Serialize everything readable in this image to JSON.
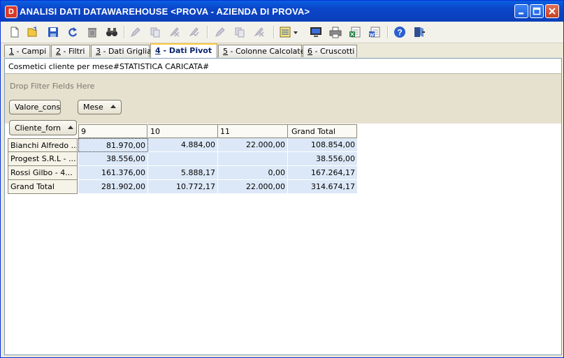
{
  "window": {
    "title": "ANALISI DATI DATAWAREHOUSE <PROVA - AZIENDA DI PROVA>",
    "app_icon_letter": "D"
  },
  "toolbar": {
    "buttons": [
      {
        "name": "new",
        "icon": "new-document-icon",
        "enabled": true
      },
      {
        "name": "open",
        "icon": "open-folder-icon",
        "enabled": true
      },
      {
        "name": "save",
        "icon": "save-disk-icon",
        "enabled": true
      },
      {
        "name": "refresh",
        "icon": "refresh-icon",
        "enabled": true
      },
      {
        "name": "delete",
        "icon": "trash-icon",
        "enabled": true
      },
      {
        "name": "find",
        "icon": "binoculars-icon",
        "enabled": true
      },
      {
        "name": "edit",
        "icon": "edit-pencil-icon",
        "enabled": false
      },
      {
        "name": "copy",
        "icon": "copy-icon",
        "enabled": false
      },
      {
        "name": "cancel",
        "icon": "cancel-x-icon",
        "enabled": false
      },
      {
        "name": "confirm",
        "icon": "confirm-check-icon",
        "enabled": false
      },
      {
        "name": "edit-2",
        "icon": "edit-pencil-icon",
        "enabled": false
      },
      {
        "name": "copy-2",
        "icon": "copy-icon",
        "enabled": false
      },
      {
        "name": "cancel-2",
        "icon": "cancel-x-icon",
        "enabled": false
      },
      {
        "name": "layout-menu",
        "icon": "list-dropdown-icon",
        "enabled": true
      },
      {
        "name": "monitor",
        "icon": "monitor-icon",
        "enabled": true
      },
      {
        "name": "print",
        "icon": "printer-icon",
        "enabled": true
      },
      {
        "name": "export-excel",
        "icon": "excel-export-icon",
        "enabled": true
      },
      {
        "name": "export-word",
        "icon": "word-export-icon",
        "enabled": true
      },
      {
        "name": "help",
        "icon": "help-icon",
        "enabled": true
      },
      {
        "name": "exit",
        "icon": "exit-door-icon",
        "enabled": true
      }
    ]
  },
  "tabs": [
    {
      "key": "1",
      "label": " - Campi"
    },
    {
      "key": "2",
      "label": " - Filtri"
    },
    {
      "key": "3",
      "label": " - Dati Griglia"
    },
    {
      "key": "4",
      "label": " - Dati Pivot",
      "active": true
    },
    {
      "key": "5",
      "label": " - Colonne Calcolate"
    },
    {
      "key": "6",
      "label": " - Cruscotti"
    }
  ],
  "pivot": {
    "caption": "Cosmetici cliente per mese#STATISTICA CARICATA#",
    "filter_hint": "Drop Filter Fields Here",
    "data_field": "Valore_cons",
    "column_field": "Mese",
    "row_field": "Cliente_forn",
    "columns": [
      "9",
      "10",
      "11",
      "Grand Total"
    ],
    "rows": [
      {
        "label": "Bianchi Alfredo ...",
        "values": [
          "81.970,00",
          "4.884,00",
          "22.000,00",
          "108.854,00"
        ]
      },
      {
        "label": "Progest S.R.L - ...",
        "values": [
          "38.556,00",
          "",
          "",
          "38.556,00"
        ]
      },
      {
        "label": "Rossi Gilbo   - 4...",
        "values": [
          "161.376,00",
          "5.888,17",
          "0,00",
          "167.264,17"
        ]
      },
      {
        "label": "Grand Total",
        "values": [
          "281.902,00",
          "10.772,17",
          "22.000,00",
          "314.674,17"
        ]
      }
    ]
  },
  "colors": {
    "titlebar": "#0b45c8",
    "value_cell": "#dce8f7",
    "pivot_area": "#e6e0cf",
    "active_tab_accent": "#ffc83c"
  }
}
